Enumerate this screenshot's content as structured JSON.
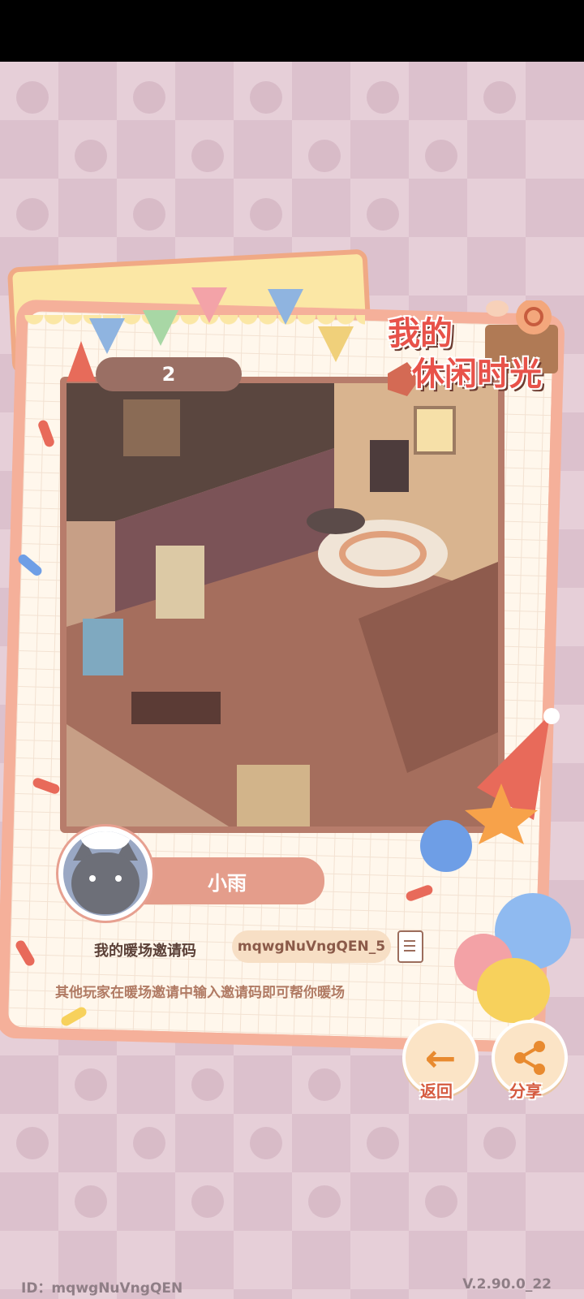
{
  "level": "2",
  "game_logo": {
    "line1": "我的",
    "line2": "休闲时光"
  },
  "player": {
    "name": "小雨"
  },
  "invite": {
    "label": "我的暖场邀请码",
    "code": "mqwgNuVngQEN_5",
    "hint": "其他玩家在暖场邀请中输入邀请码即可帮你暖场"
  },
  "buttons": {
    "back_label": "返回",
    "share_label": "分享"
  },
  "footer": {
    "id_text": "ID：mqwgNuVngQEN",
    "version": "V.2.90.0_22"
  },
  "colors": {
    "accent": "#e8524a",
    "card_border": "#f5b09a",
    "scene_frame": "#b77c6b",
    "pill": "#9a6f64"
  }
}
